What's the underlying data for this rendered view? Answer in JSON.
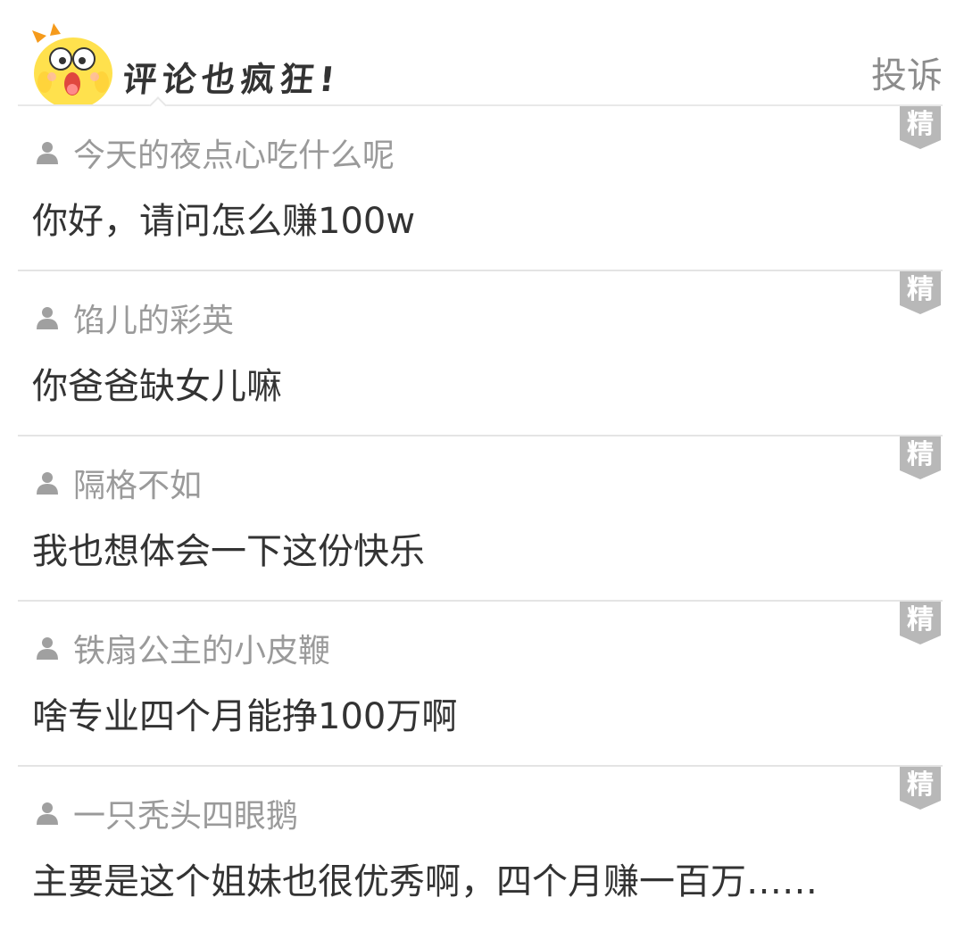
{
  "header": {
    "title": "评论也疯狂!",
    "report_label": "投诉"
  },
  "colors": {
    "username": "#9a9a9a",
    "comment_text": "#333333",
    "badge": "#b8b8b8",
    "mascot_yellow": "#ffe14d",
    "mascot_orange": "#f59a1b"
  },
  "comments": [
    {
      "username": "今天的夜点心吃什么呢",
      "text": "你好，请问怎么赚100w",
      "badge": "精",
      "user_icon": "user-icon"
    },
    {
      "username": "馅儿的彩英",
      "text": "你爸爸缺女儿嘛",
      "badge": "精",
      "user_icon": "user-icon"
    },
    {
      "username": "隔格不如",
      "text": "我也想体会一下这份快乐",
      "badge": "精",
      "user_icon": "user-icon"
    },
    {
      "username": "铁扇公主的小皮鞭",
      "text": "啥专业四个月能挣100万啊",
      "badge": "精",
      "user_icon": "user-icon"
    },
    {
      "username": "一只秃头四眼鹅",
      "text": "主要是这个姐妹也很优秀啊，四个月赚一百万……",
      "badge": "精",
      "user_icon": "user-icon"
    }
  ]
}
